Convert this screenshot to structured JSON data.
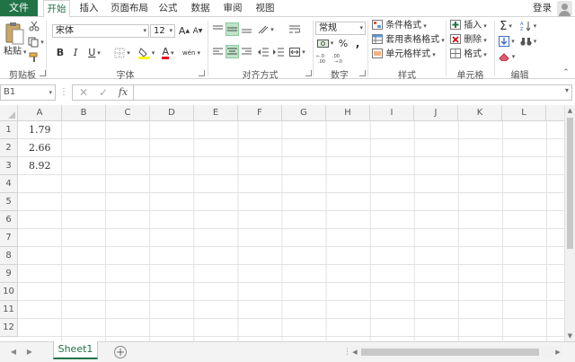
{
  "tabs": {
    "file": "文件",
    "items": [
      {
        "label": "开始",
        "active": true
      },
      {
        "label": "插入"
      },
      {
        "label": "页面布局"
      },
      {
        "label": "公式"
      },
      {
        "label": "数据"
      },
      {
        "label": "审阅"
      },
      {
        "label": "视图"
      }
    ],
    "login": "登录"
  },
  "ribbon": {
    "clipboard": {
      "paste_label": "粘贴",
      "group_label": "剪贴板"
    },
    "font": {
      "font_name": "宋体",
      "font_size": "12",
      "grow_label": "A",
      "shrink_label": "A",
      "bold": "B",
      "italic": "I",
      "underline": "U",
      "font_color_label": "A",
      "special_char_label": "wén",
      "group_label": "字体"
    },
    "alignment": {
      "group_label": "对齐方式"
    },
    "number": {
      "format": "常规",
      "percent": "%",
      "comma": ",",
      "group_label": "数字"
    },
    "styles": {
      "conditional_format": "条件格式",
      "table_format": "套用表格格式",
      "cell_style": "单元格样式",
      "group_label": "样式"
    },
    "cells": {
      "insert": "插入",
      "delete": "删除",
      "format": "格式",
      "group_label": "单元格"
    },
    "editing": {
      "group_label": "编辑"
    }
  },
  "formula_bar": {
    "name_box": "B1",
    "fx": "fx",
    "value": ""
  },
  "columns": [
    "A",
    "B",
    "C",
    "D",
    "E",
    "F",
    "G",
    "H",
    "I",
    "J",
    "K",
    "L"
  ],
  "rows": [
    "1",
    "2",
    "3",
    "4",
    "5",
    "6",
    "7",
    "8",
    "9",
    "10",
    "11",
    "12"
  ],
  "cells": {
    "A1": "1.79",
    "A2": "2.66",
    "A3": "8.92"
  },
  "sheets": [
    {
      "name": "Sheet1",
      "active": true
    }
  ],
  "colors": {
    "accent": "#217346",
    "font_color": "#e81123",
    "highlight": "#ffff00"
  }
}
